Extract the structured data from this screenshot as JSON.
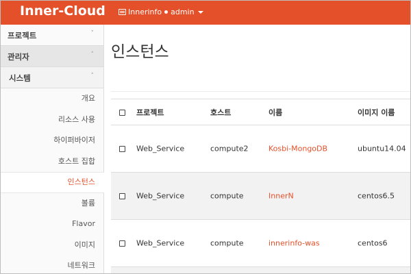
{
  "header": {
    "brand": "Inner-Cloud",
    "project": "Innerinfo",
    "user": "admin"
  },
  "sidebar": {
    "project_label": "프로젝트",
    "admin_label": "관리자",
    "system_label": "시스템",
    "items": [
      {
        "label": "개요"
      },
      {
        "label": "리소스 사용"
      },
      {
        "label": "하이퍼바이저"
      },
      {
        "label": "호스트 집합"
      },
      {
        "label": "인스턴스",
        "active": true
      },
      {
        "label": "볼륨"
      },
      {
        "label": "Flavor"
      },
      {
        "label": "이미지"
      },
      {
        "label": "네트워크"
      }
    ]
  },
  "main": {
    "title": "인스턴스",
    "table": {
      "headers": [
        "프로젝트",
        "호스트",
        "이름",
        "이미지 이름"
      ],
      "rows": [
        {
          "project": "Web_Service",
          "host": "compute2",
          "name": "Kosbi-MongoDB",
          "image": "ubuntu14.04"
        },
        {
          "project": "Web_Service",
          "host": "compute",
          "name": "InnerN",
          "image": "centos6.5"
        },
        {
          "project": "Web_Service",
          "host": "compute",
          "name": "innerinfo-was",
          "image": "centos6"
        }
      ]
    }
  },
  "colors": {
    "accent": "#e3502a"
  }
}
